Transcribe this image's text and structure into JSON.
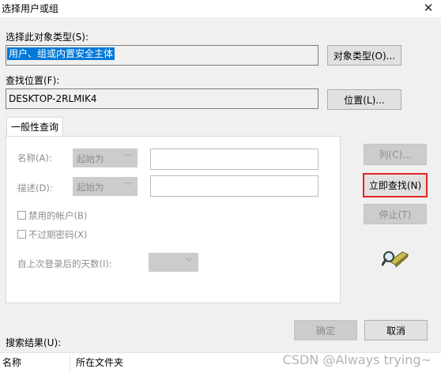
{
  "window": {
    "title": "选择用户或组",
    "close_glyph": "✕"
  },
  "object_type": {
    "label": "选择此对象类型(S):",
    "value": "用户、组或内置安全主体",
    "button": "对象类型(O)..."
  },
  "location": {
    "label": "查找位置(F):",
    "value": "DESKTOP-2RLMIK4",
    "button": "位置(L)..."
  },
  "tabs": [
    {
      "label": "一般性查询"
    }
  ],
  "query": {
    "name": {
      "label": "名称(A):",
      "mode": "起始为"
    },
    "desc": {
      "label": "描述(D):",
      "mode": "起始为"
    },
    "disabled_accounts": "禁用的帐户(B)",
    "no_expire_password": "不过期密码(X)",
    "days_since_login": "自上次登录后的天数(I):",
    "chevron": "﹀"
  },
  "side_buttons": {
    "columns": "列(C)...",
    "find_now": "立即查找(N)",
    "stop": "停止(T)"
  },
  "footer": {
    "ok": "确定",
    "cancel": "取消"
  },
  "results": {
    "label": "搜索结果(U):",
    "columns": [
      "名称",
      "所在文件夹"
    ]
  },
  "watermark": "CSDN @Always trying~",
  "colors": {
    "selection": "#0078d7",
    "highlight_border": "#e32424"
  },
  "icons": {
    "search_people": "search-people-icon"
  }
}
